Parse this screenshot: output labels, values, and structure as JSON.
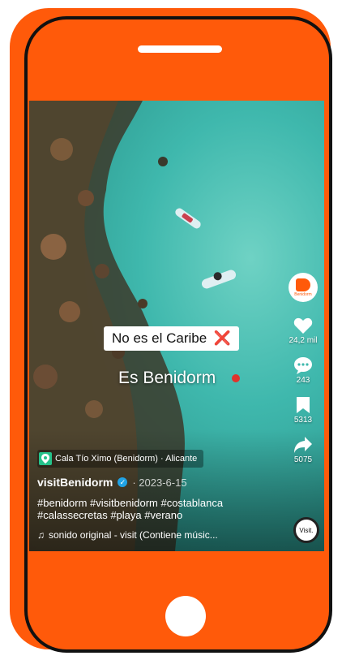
{
  "video": {
    "caption_top": "No es el Caribe",
    "caption_top_emoji": "❌",
    "caption_bottom": "Es Benidorm"
  },
  "post": {
    "location": "Cala Tío Ximo (Benidorm) · Alicante",
    "username": "visitBenidorm",
    "date": "· 2023-6-15",
    "hashtags": "#benidorm #visitbenidorm #costablanca #calassecretas #playa #verano",
    "sound": "sonido original - visit (Contiene músic..."
  },
  "actions": {
    "likes": "24,2 mil",
    "comments": "243",
    "saves": "5313",
    "shares": "5075"
  },
  "avatar_label": "Benidorm",
  "music_disc_label": "Visit.",
  "colors": {
    "frame": "#ff5a0a",
    "water": "#3fb8ad",
    "verified": "#20a3e6"
  }
}
